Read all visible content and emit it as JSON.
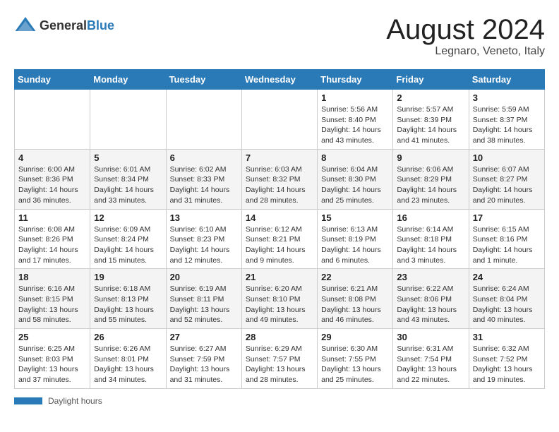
{
  "header": {
    "logo_general": "General",
    "logo_blue": "Blue",
    "title": "August 2024",
    "subtitle": "Legnaro, Veneto, Italy"
  },
  "columns": [
    "Sunday",
    "Monday",
    "Tuesday",
    "Wednesday",
    "Thursday",
    "Friday",
    "Saturday"
  ],
  "weeks": [
    {
      "days": [
        {
          "number": "",
          "info": ""
        },
        {
          "number": "",
          "info": ""
        },
        {
          "number": "",
          "info": ""
        },
        {
          "number": "",
          "info": ""
        },
        {
          "number": "1",
          "info": "Sunrise: 5:56 AM\nSunset: 8:40 PM\nDaylight: 14 hours and 43 minutes."
        },
        {
          "number": "2",
          "info": "Sunrise: 5:57 AM\nSunset: 8:39 PM\nDaylight: 14 hours and 41 minutes."
        },
        {
          "number": "3",
          "info": "Sunrise: 5:59 AM\nSunset: 8:37 PM\nDaylight: 14 hours and 38 minutes."
        }
      ]
    },
    {
      "days": [
        {
          "number": "4",
          "info": "Sunrise: 6:00 AM\nSunset: 8:36 PM\nDaylight: 14 hours and 36 minutes."
        },
        {
          "number": "5",
          "info": "Sunrise: 6:01 AM\nSunset: 8:34 PM\nDaylight: 14 hours and 33 minutes."
        },
        {
          "number": "6",
          "info": "Sunrise: 6:02 AM\nSunset: 8:33 PM\nDaylight: 14 hours and 31 minutes."
        },
        {
          "number": "7",
          "info": "Sunrise: 6:03 AM\nSunset: 8:32 PM\nDaylight: 14 hours and 28 minutes."
        },
        {
          "number": "8",
          "info": "Sunrise: 6:04 AM\nSunset: 8:30 PM\nDaylight: 14 hours and 25 minutes."
        },
        {
          "number": "9",
          "info": "Sunrise: 6:06 AM\nSunset: 8:29 PM\nDaylight: 14 hours and 23 minutes."
        },
        {
          "number": "10",
          "info": "Sunrise: 6:07 AM\nSunset: 8:27 PM\nDaylight: 14 hours and 20 minutes."
        }
      ]
    },
    {
      "days": [
        {
          "number": "11",
          "info": "Sunrise: 6:08 AM\nSunset: 8:26 PM\nDaylight: 14 hours and 17 minutes."
        },
        {
          "number": "12",
          "info": "Sunrise: 6:09 AM\nSunset: 8:24 PM\nDaylight: 14 hours and 15 minutes."
        },
        {
          "number": "13",
          "info": "Sunrise: 6:10 AM\nSunset: 8:23 PM\nDaylight: 14 hours and 12 minutes."
        },
        {
          "number": "14",
          "info": "Sunrise: 6:12 AM\nSunset: 8:21 PM\nDaylight: 14 hours and 9 minutes."
        },
        {
          "number": "15",
          "info": "Sunrise: 6:13 AM\nSunset: 8:19 PM\nDaylight: 14 hours and 6 minutes."
        },
        {
          "number": "16",
          "info": "Sunrise: 6:14 AM\nSunset: 8:18 PM\nDaylight: 14 hours and 3 minutes."
        },
        {
          "number": "17",
          "info": "Sunrise: 6:15 AM\nSunset: 8:16 PM\nDaylight: 14 hours and 1 minute."
        }
      ]
    },
    {
      "days": [
        {
          "number": "18",
          "info": "Sunrise: 6:16 AM\nSunset: 8:15 PM\nDaylight: 13 hours and 58 minutes."
        },
        {
          "number": "19",
          "info": "Sunrise: 6:18 AM\nSunset: 8:13 PM\nDaylight: 13 hours and 55 minutes."
        },
        {
          "number": "20",
          "info": "Sunrise: 6:19 AM\nSunset: 8:11 PM\nDaylight: 13 hours and 52 minutes."
        },
        {
          "number": "21",
          "info": "Sunrise: 6:20 AM\nSunset: 8:10 PM\nDaylight: 13 hours and 49 minutes."
        },
        {
          "number": "22",
          "info": "Sunrise: 6:21 AM\nSunset: 8:08 PM\nDaylight: 13 hours and 46 minutes."
        },
        {
          "number": "23",
          "info": "Sunrise: 6:22 AM\nSunset: 8:06 PM\nDaylight: 13 hours and 43 minutes."
        },
        {
          "number": "24",
          "info": "Sunrise: 6:24 AM\nSunset: 8:04 PM\nDaylight: 13 hours and 40 minutes."
        }
      ]
    },
    {
      "days": [
        {
          "number": "25",
          "info": "Sunrise: 6:25 AM\nSunset: 8:03 PM\nDaylight: 13 hours and 37 minutes."
        },
        {
          "number": "26",
          "info": "Sunrise: 6:26 AM\nSunset: 8:01 PM\nDaylight: 13 hours and 34 minutes."
        },
        {
          "number": "27",
          "info": "Sunrise: 6:27 AM\nSunset: 7:59 PM\nDaylight: 13 hours and 31 minutes."
        },
        {
          "number": "28",
          "info": "Sunrise: 6:29 AM\nSunset: 7:57 PM\nDaylight: 13 hours and 28 minutes."
        },
        {
          "number": "29",
          "info": "Sunrise: 6:30 AM\nSunset: 7:55 PM\nDaylight: 13 hours and 25 minutes."
        },
        {
          "number": "30",
          "info": "Sunrise: 6:31 AM\nSunset: 7:54 PM\nDaylight: 13 hours and 22 minutes."
        },
        {
          "number": "31",
          "info": "Sunrise: 6:32 AM\nSunset: 7:52 PM\nDaylight: 13 hours and 19 minutes."
        }
      ]
    }
  ],
  "footer": {
    "daylight_label": "Daylight hours"
  }
}
